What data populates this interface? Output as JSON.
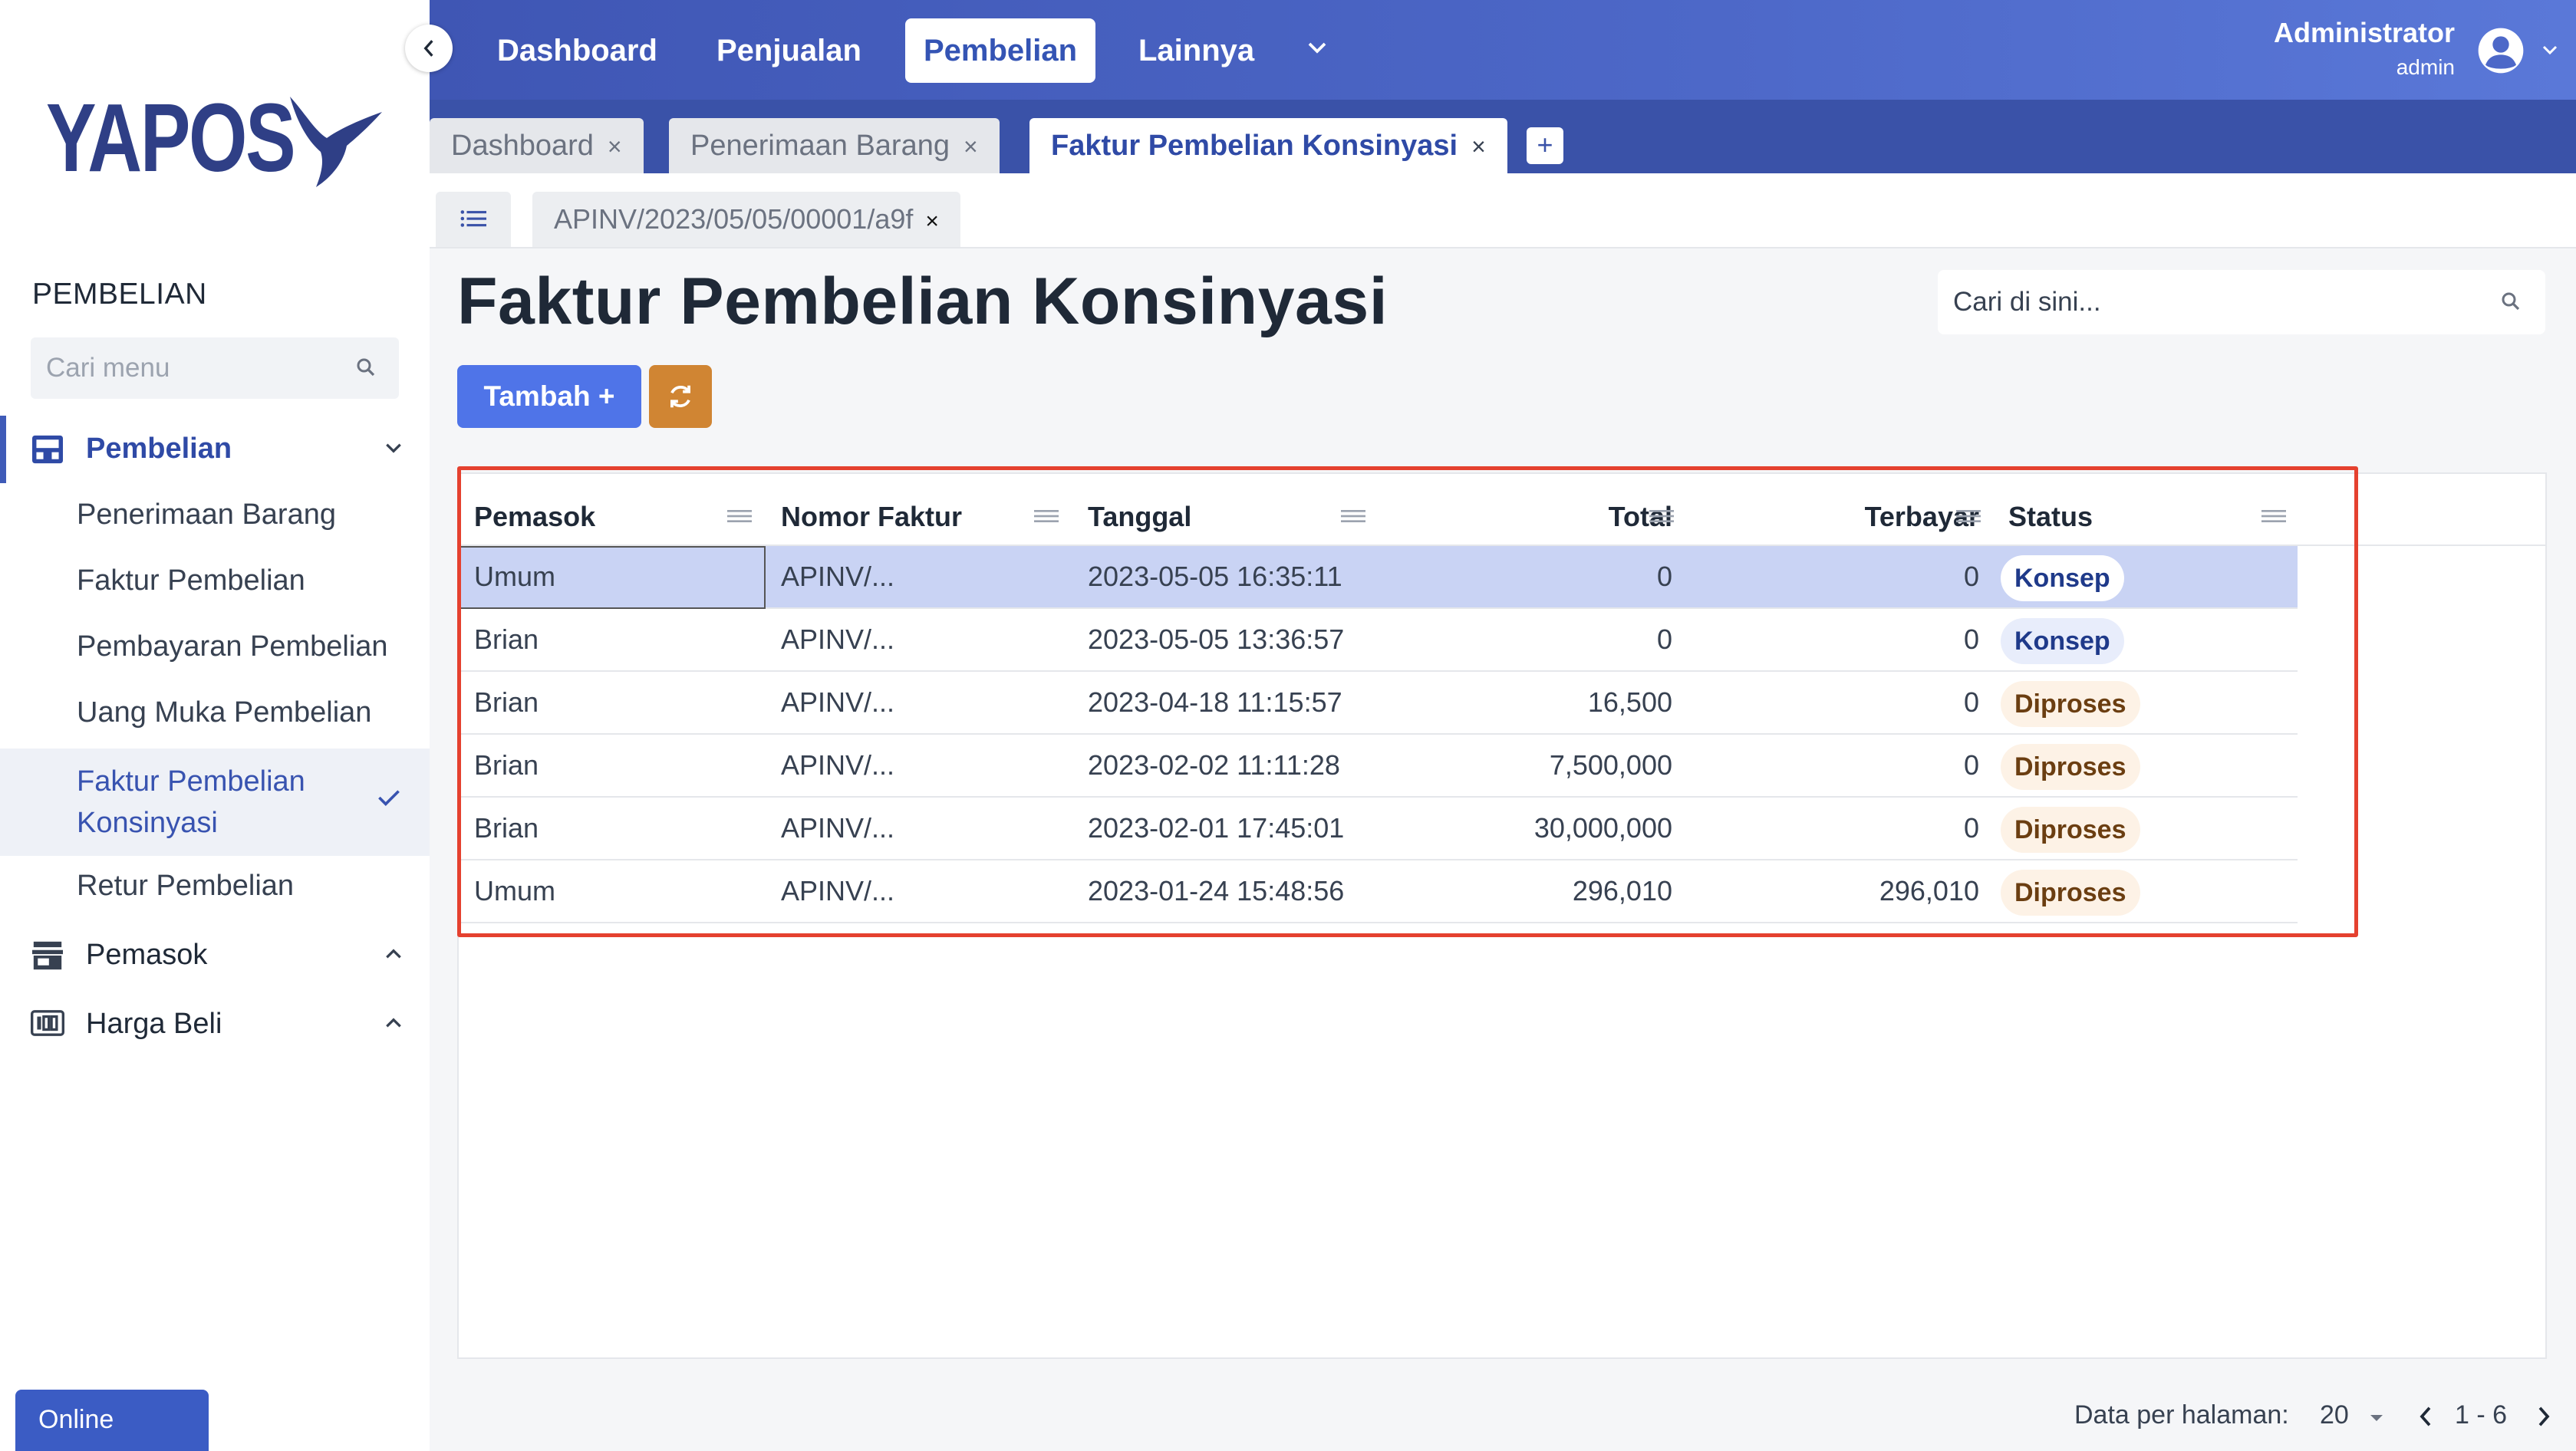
{
  "brand": {
    "logo_text": "YAPOS"
  },
  "sidebar": {
    "heading": "PEMBELIAN",
    "search_placeholder": "Cari menu",
    "groups": [
      {
        "label": "Pembelian",
        "icon": "inbox-icon",
        "expanded": true
      },
      {
        "label": "Pemasok",
        "icon": "store-icon",
        "expanded": false
      },
      {
        "label": "Harga Beli",
        "icon": "price-tag-icon",
        "expanded": false
      }
    ],
    "items": [
      {
        "label": "Penerimaan Barang"
      },
      {
        "label": "Faktur Pembelian"
      },
      {
        "label": "Pembayaran Pembelian"
      },
      {
        "label": "Uang Muka Pembelian"
      },
      {
        "label": "Faktur Pembelian Konsinyasi",
        "active": true
      },
      {
        "label": "Retur Pembelian"
      }
    ],
    "status_button": "Online"
  },
  "topnav": {
    "items": [
      {
        "label": "Dashboard"
      },
      {
        "label": "Penjualan"
      },
      {
        "label": "Pembelian",
        "active": true
      },
      {
        "label": "Lainnya"
      }
    ],
    "user": {
      "name": "Administrator",
      "role": "admin"
    }
  },
  "window_tabs": [
    {
      "label": "Dashboard",
      "close": "×"
    },
    {
      "label": "Penerimaan Barang",
      "close": "×"
    },
    {
      "label": "Faktur Pembelian Konsinyasi",
      "close": "×",
      "active": true
    }
  ],
  "tab_add_label": "+",
  "doc_tab": {
    "label": "APINV/2023/05/05/00001/a9f",
    "close": "×"
  },
  "page": {
    "title": "Faktur Pembelian Konsinyasi",
    "search_placeholder": "Cari di sini...",
    "add_button": "Tambah +"
  },
  "table": {
    "columns": [
      "Pemasok",
      "Nomor Faktur",
      "Tanggal",
      "Total",
      "Terbayar",
      "Status"
    ],
    "rows": [
      {
        "pemasok": "Umum",
        "nomor": "APINV/...",
        "tanggal": "2023-05-05 16:35:11",
        "total": "0",
        "terbayar": "0",
        "status": "Konsep"
      },
      {
        "pemasok": "Brian",
        "nomor": "APINV/...",
        "tanggal": "2023-05-05 13:36:57",
        "total": "0",
        "terbayar": "0",
        "status": "Konsep"
      },
      {
        "pemasok": "Brian",
        "nomor": "APINV/...",
        "tanggal": "2023-04-18 11:15:57",
        "total": "16,500",
        "terbayar": "0",
        "status": "Diproses"
      },
      {
        "pemasok": "Brian",
        "nomor": "APINV/...",
        "tanggal": "2023-02-02 11:11:28",
        "total": "7,500,000",
        "terbayar": "0",
        "status": "Diproses"
      },
      {
        "pemasok": "Brian",
        "nomor": "APINV/...",
        "tanggal": "2023-02-01 17:45:01",
        "total": "30,000,000",
        "terbayar": "0",
        "status": "Diproses"
      },
      {
        "pemasok": "Umum",
        "nomor": "APINV/...",
        "tanggal": "2023-01-24 15:48:56",
        "total": "296,010",
        "terbayar": "296,010",
        "status": "Diproses"
      }
    ]
  },
  "pagination": {
    "label": "Data per halaman:",
    "per_page": "20",
    "range": "1 - 6"
  },
  "colors": {
    "primary": "#3f56b4",
    "accent_button": "#4f74e8",
    "refresh_button": "#d08533",
    "highlight": "#e5412f",
    "status_konsep": "#1f3a8a",
    "status_diproses": "#6b3e11"
  }
}
